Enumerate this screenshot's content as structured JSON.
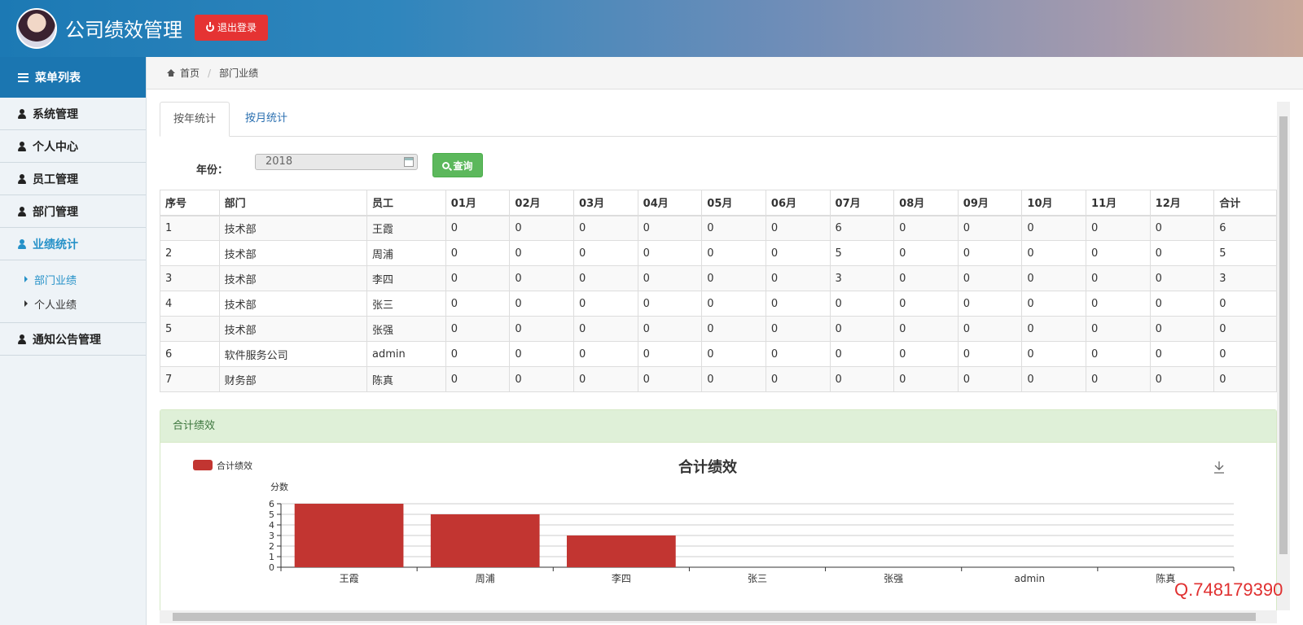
{
  "header": {
    "title": "公司绩效管理",
    "logout_label": "退出登录"
  },
  "sidebar": {
    "menu_title": "菜单列表",
    "items": [
      {
        "label": "系统管理"
      },
      {
        "label": "个人中心"
      },
      {
        "label": "员工管理"
      },
      {
        "label": "部门管理"
      },
      {
        "label": "业绩统计"
      },
      {
        "label": "通知公告管理"
      }
    ],
    "sub_items": [
      {
        "label": "部门业绩"
      },
      {
        "label": "个人业绩"
      }
    ]
  },
  "breadcrumb": {
    "home": "首页",
    "current": "部门业绩"
  },
  "tabs": [
    {
      "label": "按年统计"
    },
    {
      "label": "按月统计"
    }
  ],
  "filter": {
    "year_label": "年份：",
    "year_value": "2018",
    "query_label": "查询"
  },
  "table": {
    "headers": [
      "序号",
      "部门",
      "员工",
      "01月",
      "02月",
      "03月",
      "04月",
      "05月",
      "06月",
      "07月",
      "08月",
      "09月",
      "10月",
      "11月",
      "12月",
      "合计"
    ],
    "rows": [
      [
        "1",
        "技术部",
        "王霞",
        "0",
        "0",
        "0",
        "0",
        "0",
        "0",
        "6",
        "0",
        "0",
        "0",
        "0",
        "0",
        "6"
      ],
      [
        "2",
        "技术部",
        "周浦",
        "0",
        "0",
        "0",
        "0",
        "0",
        "0",
        "5",
        "0",
        "0",
        "0",
        "0",
        "0",
        "5"
      ],
      [
        "3",
        "技术部",
        "李四",
        "0",
        "0",
        "0",
        "0",
        "0",
        "0",
        "3",
        "0",
        "0",
        "0",
        "0",
        "0",
        "3"
      ],
      [
        "4",
        "技术部",
        "张三",
        "0",
        "0",
        "0",
        "0",
        "0",
        "0",
        "0",
        "0",
        "0",
        "0",
        "0",
        "0",
        "0"
      ],
      [
        "5",
        "技术部",
        "张强",
        "0",
        "0",
        "0",
        "0",
        "0",
        "0",
        "0",
        "0",
        "0",
        "0",
        "0",
        "0",
        "0"
      ],
      [
        "6",
        "软件服务公司",
        "admin",
        "0",
        "0",
        "0",
        "0",
        "0",
        "0",
        "0",
        "0",
        "0",
        "0",
        "0",
        "0",
        "0"
      ],
      [
        "7",
        "财务部",
        "陈真",
        "0",
        "0",
        "0",
        "0",
        "0",
        "0",
        "0",
        "0",
        "0",
        "0",
        "0",
        "0",
        "0"
      ]
    ]
  },
  "panel": {
    "title": "合计绩效"
  },
  "chart_data": {
    "type": "bar",
    "title": "合计绩效",
    "legend": "合计绩效",
    "legend_position": "top-left",
    "ylabel": "分数",
    "ylim": [
      0,
      6
    ],
    "categories": [
      "王霞",
      "周浦",
      "李四",
      "张三",
      "张强",
      "admin",
      "陈真"
    ],
    "values": [
      6,
      5,
      3,
      0,
      0,
      0,
      0
    ],
    "color": "#c23531",
    "grid": true
  },
  "watermark": "Q.748179390"
}
